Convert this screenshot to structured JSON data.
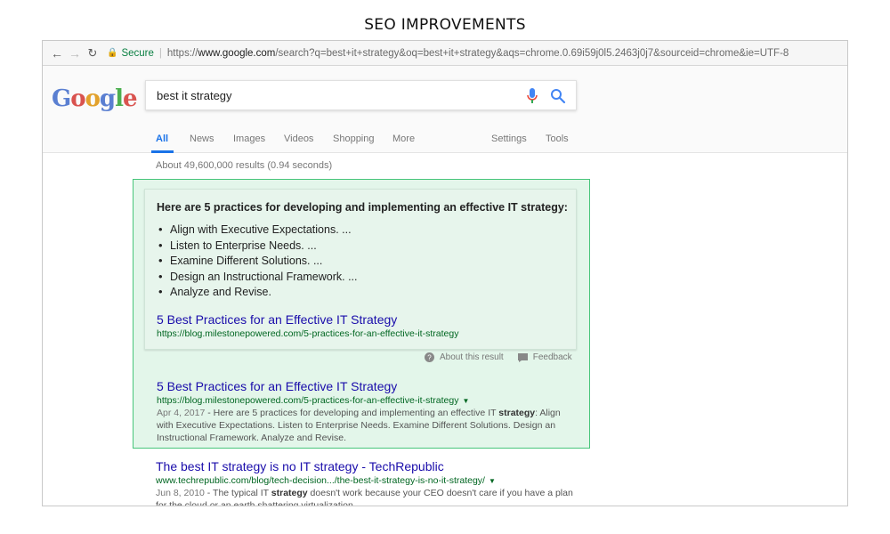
{
  "heading": "SEO IMPROVEMENTS",
  "address_bar": {
    "secure_label": "Secure",
    "url_protocol": "https://",
    "url_host": "www.google.com",
    "url_path": "/search?q=best+it+strategy&oq=best+it+strategy&aqs=chrome.0.69i59j0l5.2463j0j7&sourceid=chrome&ie=UTF-8"
  },
  "logo_text": [
    "G",
    "o",
    "o",
    "g",
    "l",
    "e"
  ],
  "search": {
    "query": "best it strategy"
  },
  "tabs": {
    "all": "All",
    "news": "News",
    "images": "Images",
    "videos": "Videos",
    "shopping": "Shopping",
    "more": "More",
    "settings": "Settings",
    "tools": "Tools"
  },
  "result_stats": "About 49,600,000 results (0.94 seconds)",
  "snippet": {
    "title": "Here are 5 practices for developing and implementing an effective IT strategy:",
    "items": [
      "Align with Executive Expectations. ...",
      "Listen to Enterprise Needs. ...",
      "Examine Different Solutions. ...",
      "Design an Instructional Framework. ...",
      "Analyze and Revise."
    ],
    "link_title": "5 Best Practices for an Effective IT Strategy",
    "link_url": "https://blog.milestonepowered.com/5-practices-for-an-effective-it-strategy",
    "about_label": "About this result",
    "feedback_label": "Feedback"
  },
  "results": [
    {
      "title": "5 Best Practices for an Effective IT Strategy",
      "url": "https://blog.milestonepowered.com/5-practices-for-an-effective-it-strategy",
      "date": "Apr 4, 2017",
      "desc_before": " - Here are 5 practices for developing and implementing an effective IT ",
      "desc_bold": "strategy",
      "desc_after": ": Align with Executive Expectations. Listen to Enterprise Needs. Examine Different Solutions. Design an Instructional Framework. Analyze and Revise."
    },
    {
      "title": "The best IT strategy is no IT strategy - TechRepublic",
      "url": "www.techrepublic.com/blog/tech-decision.../the-best-it-strategy-is-no-it-strategy/",
      "date": "Jun 8, 2010",
      "desc_before": " - The typical IT ",
      "desc_bold": "strategy",
      "desc_after": " doesn't work because your CEO doesn't care if you have a plan for the cloud or an earth shattering virtualization ..."
    }
  ],
  "colors": {
    "highlight_fill": "#e3f6ea",
    "highlight_border": "#47c57a",
    "link": "#1a0dab",
    "url": "#006621"
  }
}
